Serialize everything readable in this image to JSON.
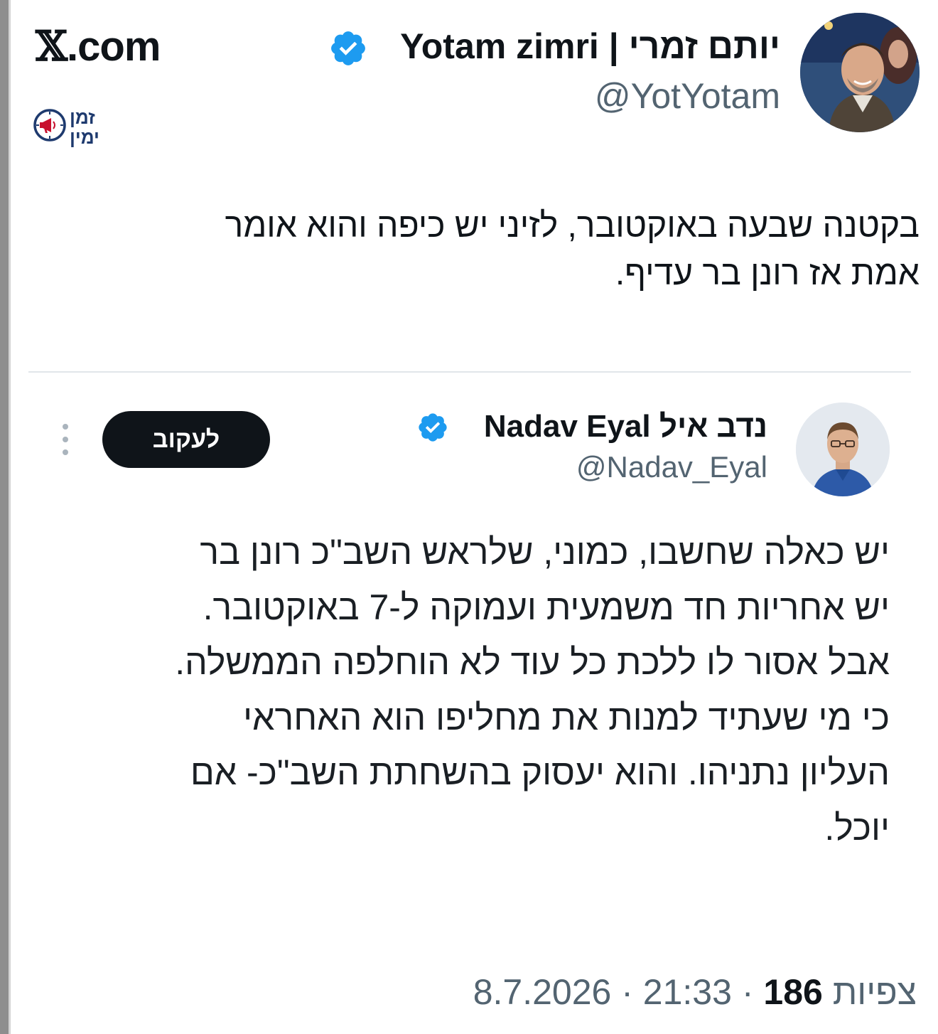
{
  "site": {
    "logo_text": ".com",
    "logo_glyph": "𝕏"
  },
  "channel_logo": {
    "line1": "זמן",
    "line2": "ימין",
    "icon": "clock-megaphone-icon"
  },
  "tweet": {
    "author_name": "יותם זמרי | Yotam zimri",
    "author_handle": "@YotYotam",
    "verified": true,
    "text_lines": [
      "בקטנה שבעה באוקטובר, לזיני יש כיפה והוא אומר",
      "אמת אז רונן בר עדיף."
    ],
    "date": "8.7.2026",
    "time": "21:33",
    "separator": "·",
    "views_count": "186",
    "views_label": "צפיות"
  },
  "quoted_tweet": {
    "author_name": "נדב איל Nadav Eyal",
    "author_handle": "@Nadav_Eyal",
    "verified": true,
    "follow_label": "לעקוב",
    "text_lines": [
      "יש כאלה שחשבו, כמוני, שלראש השב\"כ רונן בר",
      "יש אחריות חד משמעית ועמוקה ל-7 באוקטובר.",
      "אבל אסור לו ללכת כל עוד לא הוחלפה הממשלה.",
      "כי מי שעתיד למנות את מחליפו הוא האחראי",
      "העליון נתניהו. והוא יעסוק בהשחתת השב\"כ- אם",
      "יוכל."
    ]
  },
  "colors": {
    "verified_blue": "#1d9bf0",
    "text_primary": "#0f1419",
    "text_secondary": "#536471",
    "follow_button_bg": "#0f1419"
  }
}
